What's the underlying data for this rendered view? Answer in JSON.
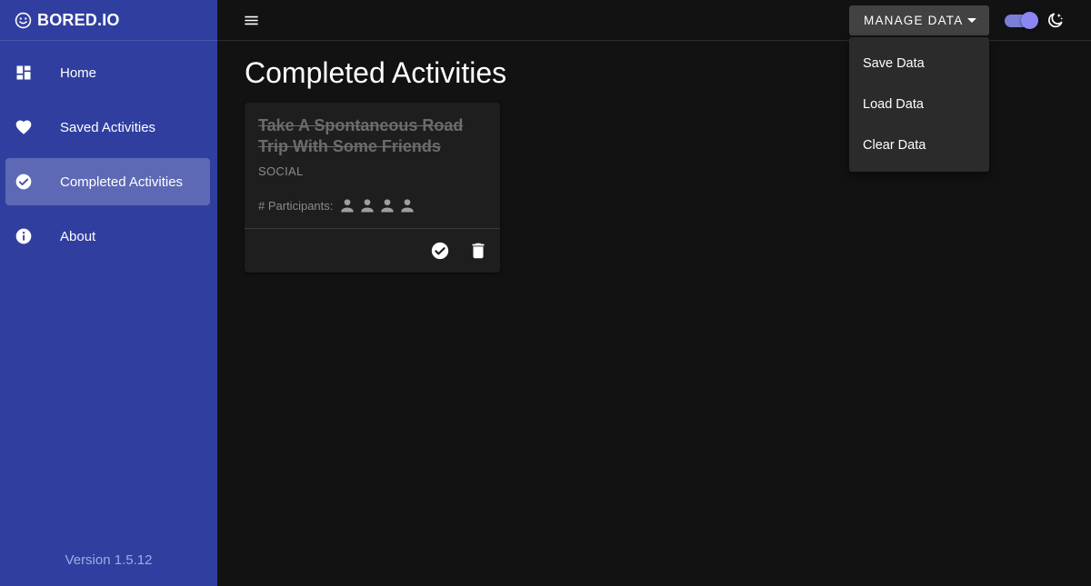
{
  "sidebar": {
    "brand": "BORED.IO",
    "items": [
      {
        "label": "Home",
        "icon": "dashboard-icon"
      },
      {
        "label": "Saved Activities",
        "icon": "heart-icon"
      },
      {
        "label": "Completed Activities",
        "icon": "check-circle-icon",
        "active": true
      },
      {
        "label": "About",
        "icon": "info-icon"
      }
    ],
    "version": "Version 1.5.12"
  },
  "topbar": {
    "manage_label": "MANAGE DATA",
    "theme_toggle": "on",
    "theme_icon": "moon-icon"
  },
  "dropdown": {
    "items": [
      "Save Data",
      "Load Data",
      "Clear Data"
    ]
  },
  "main": {
    "title": "Completed Activities",
    "card": {
      "title": "Take A Spontaneous Road Trip With Some Friends",
      "type": "SOCIAL",
      "participants_label": "# Participants:",
      "participants_count": 4
    }
  },
  "colors": {
    "sidebar": "#303f9f",
    "background": "#121212",
    "card": "#1e1e1e",
    "menu": "#2b2b2b",
    "toggle": "#8c86f2"
  }
}
